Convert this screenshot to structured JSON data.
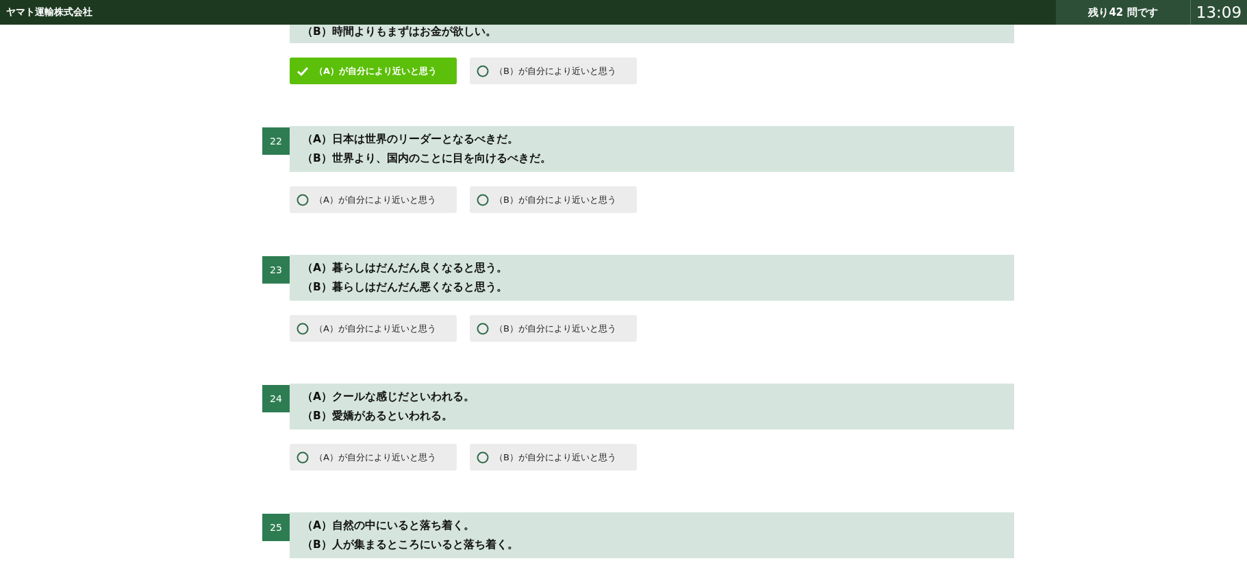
{
  "header": {
    "company": "ヤマト運輸株式会社",
    "remaining": "残り42 問です",
    "time": "13:09"
  },
  "questions": [
    {
      "lines": [
        "（B）時間よりもまずはお金が欲しい。"
      ],
      "options": [
        {
          "label": "（A）が自分により近いと思う",
          "selected": true
        },
        {
          "label": "（B）が自分により近いと思う",
          "selected": false
        }
      ]
    },
    {
      "number": "22",
      "lines": [
        "（A）日本は世界のリーダーとなるべきだ。",
        "（B）世界より、国内のことに目を向けるべきだ。"
      ],
      "options": [
        {
          "label": "（A）が自分により近いと思う",
          "selected": false
        },
        {
          "label": "（B）が自分により近いと思う",
          "selected": false
        }
      ]
    },
    {
      "number": "23",
      "lines": [
        "（A）暮らしはだんだん良くなると思う。",
        "（B）暮らしはだんだん悪くなると思う。"
      ],
      "options": [
        {
          "label": "（A）が自分により近いと思う",
          "selected": false
        },
        {
          "label": "（B）が自分により近いと思う",
          "selected": false
        }
      ]
    },
    {
      "number": "24",
      "lines": [
        "（A）クールな感じだといわれる。",
        "（B）愛嬌があるといわれる。"
      ],
      "options": [
        {
          "label": "（A）が自分により近いと思う",
          "selected": false
        },
        {
          "label": "（B）が自分により近いと思う",
          "selected": false
        }
      ]
    },
    {
      "number": "25",
      "lines": [
        "（A）自然の中にいると落ち着く。",
        "（B）人が集まるところにいると落ち着く。"
      ]
    }
  ]
}
